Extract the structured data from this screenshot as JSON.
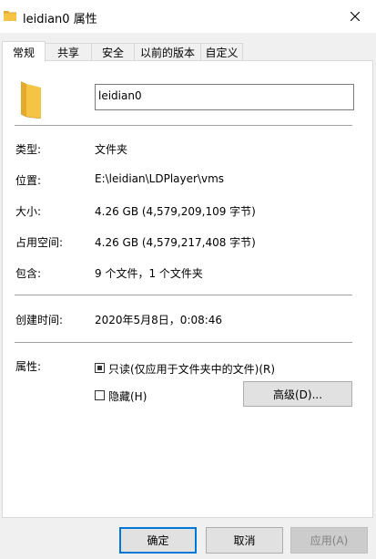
{
  "window": {
    "title": "leidian0 属性"
  },
  "tabs": [
    {
      "label": "常规",
      "active": true
    },
    {
      "label": "共享"
    },
    {
      "label": "安全"
    },
    {
      "label": "以前的版本"
    },
    {
      "label": "自定义"
    }
  ],
  "general": {
    "name_value": "leidian0",
    "type": {
      "label": "类型:",
      "value": "文件夹"
    },
    "location": {
      "label": "位置:",
      "value": "E:\\leidian\\LDPlayer\\vms"
    },
    "size": {
      "label": "大小:",
      "value": "4.26 GB (4,579,209,109 字节)"
    },
    "size_on_disk": {
      "label": "占用空间:",
      "value": "4.26 GB (4,579,217,408 字节)"
    },
    "contains": {
      "label": "包含:",
      "value": "9 个文件，1 个文件夹"
    },
    "created": {
      "label": "创建时间:",
      "value": "2020年5月8日，0:08:46"
    },
    "attributes": {
      "label": "属性:",
      "readonly_label": "只读(仅应用于文件夹中的文件)(R)",
      "readonly_checked": true,
      "hidden_label": "隐藏(H)",
      "hidden_checked": false,
      "advanced_label": "高级(D)..."
    }
  },
  "footer": {
    "ok_label": "确定",
    "cancel_label": "取消",
    "apply_label": "应用(A)"
  },
  "colors": {
    "folder": "#f6c444",
    "folder_dark": "#e5a92c",
    "accent": "#0078d7"
  }
}
